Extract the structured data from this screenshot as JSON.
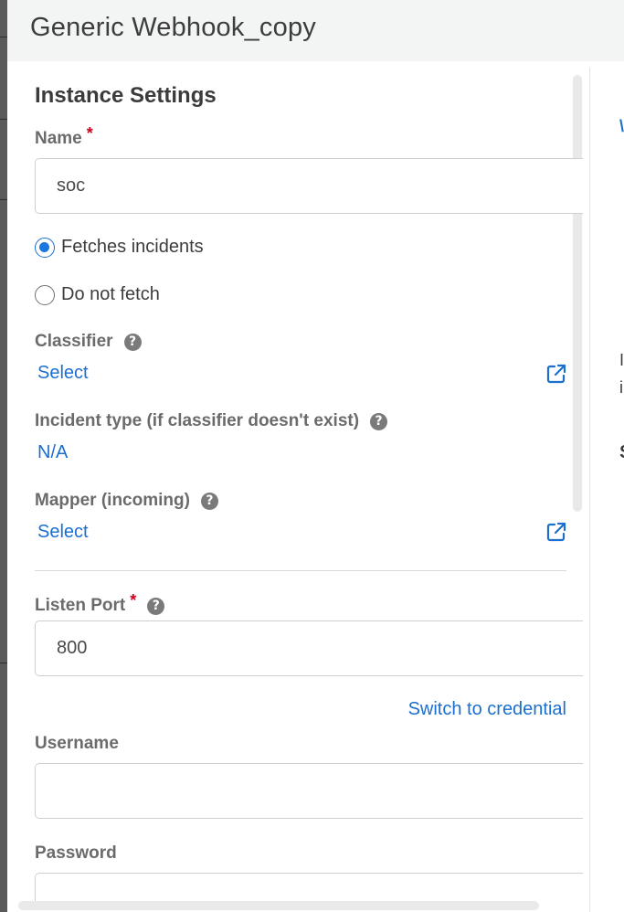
{
  "dialog": {
    "title": "Generic Webhook_copy"
  },
  "settings": {
    "section_title": "Instance Settings",
    "name": {
      "label": "Name",
      "required": "*",
      "value": "soc"
    },
    "fetch_options": [
      {
        "label": "Fetches incidents",
        "selected": true
      },
      {
        "label": "Do not fetch",
        "selected": false
      }
    ],
    "classifier": {
      "label": "Classifier",
      "help": "?",
      "value": "Select"
    },
    "incident_type": {
      "label": "Incident type (if classifier doesn't exist)",
      "help": "?",
      "value": "N/A"
    },
    "mapper": {
      "label": "Mapper (incoming)",
      "help": "?",
      "value": "Select"
    },
    "listen_port": {
      "label": "Listen Port",
      "required": "*",
      "help": "?",
      "value": "800"
    },
    "switch_credential": "Switch to credential",
    "username": {
      "label": "Username",
      "value": ""
    },
    "password": {
      "label": "Password",
      "value": ""
    }
  },
  "colors": {
    "link": "#1a6fcf",
    "required": "#d0021b",
    "radio_selected": "#1a78e0",
    "header_bg": "#f3f4f4"
  },
  "icons": {
    "external_link": "external-link-icon",
    "help": "question-circle-icon"
  }
}
